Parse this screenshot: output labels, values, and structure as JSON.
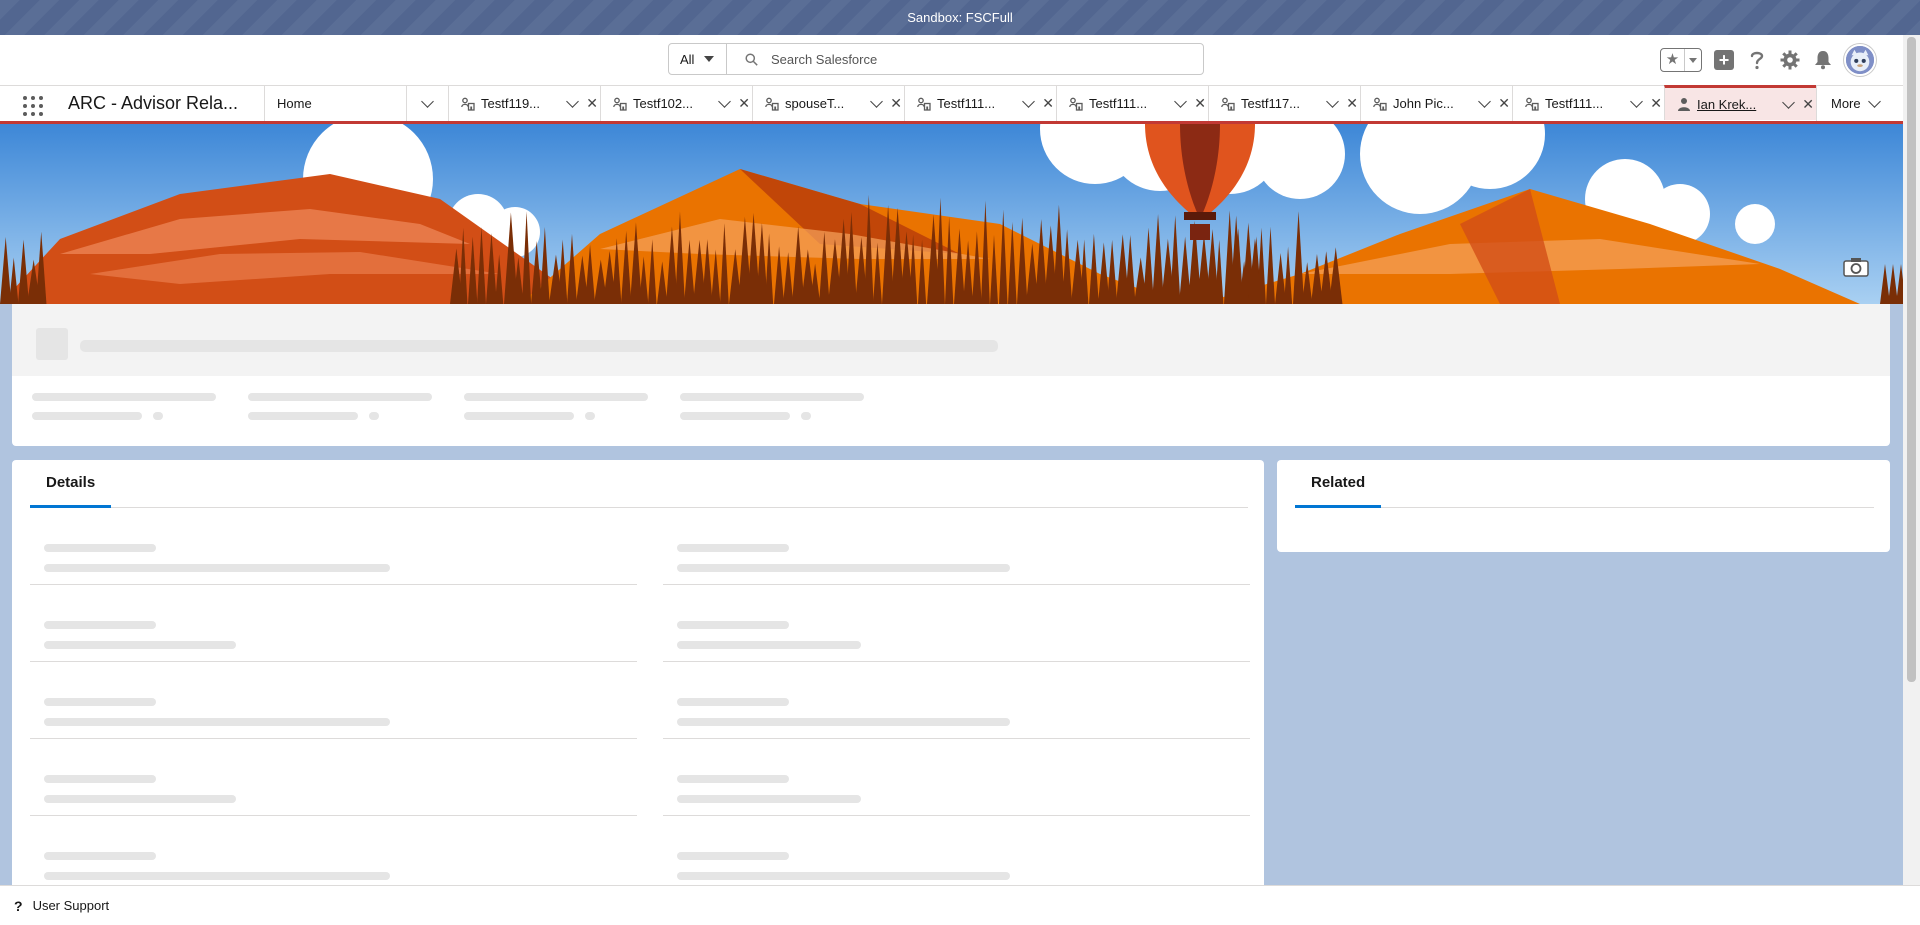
{
  "sandbox": {
    "label": "Sandbox: FSCFull"
  },
  "header": {
    "search_scope": "All",
    "search_placeholder": "Search Salesforce",
    "icons": [
      "favorites-star-icon",
      "add-icon",
      "help-icon",
      "setup-gear-icon",
      "notifications-bell-icon",
      "user-avatar"
    ]
  },
  "nav": {
    "app_name": "ARC - Advisor Rela...",
    "home_label": "Home",
    "tabs": [
      {
        "label": "Testf119...",
        "icon": "household-icon"
      },
      {
        "label": "Testf102...",
        "icon": "household-icon"
      },
      {
        "label": "spouseT...",
        "icon": "household-icon"
      },
      {
        "label": "Testf111...",
        "icon": "household-icon"
      },
      {
        "label": "Testf111...",
        "icon": "household-icon"
      },
      {
        "label": "Testf117...",
        "icon": "household-icon"
      },
      {
        "label": "John Pic...",
        "icon": "household-icon"
      },
      {
        "label": "Testf111...",
        "icon": "household-icon"
      },
      {
        "label": "Ian Krek...",
        "icon": "person-icon",
        "active": true
      }
    ],
    "more_label": "More"
  },
  "details": {
    "tab_label": "Details"
  },
  "related": {
    "tab_label": "Related"
  },
  "footer": {
    "label": "User Support"
  },
  "colors": {
    "brand_red": "#c23934",
    "tab_underline": "#0176d3",
    "page_bg": "#b0c4df"
  }
}
